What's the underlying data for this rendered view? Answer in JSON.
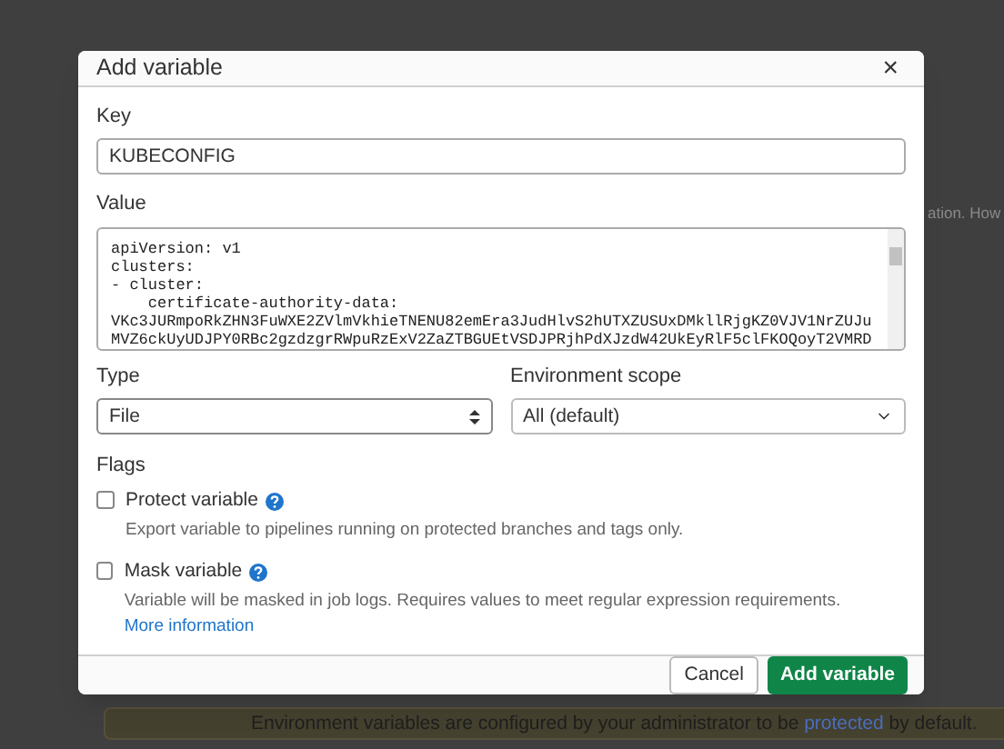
{
  "background": {
    "partial_text": "ation. How",
    "banner": {
      "text_before": "Environment variables are configured by your administrator to be",
      "link": "protected",
      "text_after": "by default."
    }
  },
  "dialog": {
    "title": "Add variable",
    "close": "×",
    "key": {
      "label": "Key",
      "value": "KUBECONFIG"
    },
    "value": {
      "label": "Value",
      "lines": [
        "apiVersion: v1",
        "clusters:",
        "- cluster:",
        "    certificate-authority-data:",
        "VKc3JURmpoRkZHN3FuWXE2ZVlmVkhieTNENU82emEra3JudHlvS2hUTXZUSUxDMkllRjgKZ0VJV1NrZUJu",
        "MVZ6ckUyUDJPY0RBc2gzdzgrRWpuRzExV2ZaZTBGUEtVSDJPRjhPdXJzdW42UkEyRlF5clFKOQoyT2VMRD"
      ]
    },
    "type": {
      "label": "Type",
      "value": "File"
    },
    "scope": {
      "label": "Environment scope",
      "value": "All (default)"
    },
    "flags": {
      "label": "Flags",
      "items": [
        {
          "label": "Protect variable",
          "checked": false,
          "description": "Export variable to pipelines running on protected branches and tags only."
        },
        {
          "label": "Mask variable",
          "checked": false,
          "description": "Variable will be masked in job logs. Requires values to meet regular expression requirements.",
          "link": "More information"
        }
      ]
    },
    "buttons": [
      {
        "label": "Cancel",
        "kind": "secondary"
      },
      {
        "label": "Add variable",
        "kind": "primary"
      }
    ]
  }
}
